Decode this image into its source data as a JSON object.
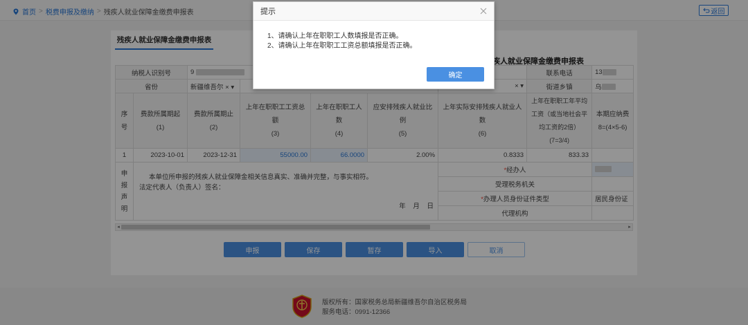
{
  "breadcrumb": {
    "home": "首页",
    "tax_link": "税费申报及缴纳",
    "current": "残疾人就业保障金缴费申报表",
    "sep": ">"
  },
  "back_label": "返回",
  "tab_label": "残疾人就业保障金缴费申报表",
  "form_title": "残疾人就业保障金缴费申报表",
  "info_rows": {
    "taxpayer_id_label": "纳税人识别号",
    "taxpayer_id_value": "9",
    "phone_label": "联系电话",
    "phone_value": "13",
    "province_label": "省份",
    "province_value": "新疆维吾尔",
    "province_clear": "×",
    "dropdown_arrow": "▾",
    "street_label": "街道乡镇",
    "street_value": "乌",
    "unknown_clear": "×"
  },
  "columns": [
    {
      "line1": "序号",
      "line2": ""
    },
    {
      "line1": "费款所属期起",
      "line2": "(1)"
    },
    {
      "line1": "费款所属期止",
      "line2": "(2)"
    },
    {
      "line1": "上年在职职工工资总额",
      "line2": "(3)"
    },
    {
      "line1": "上年在职职工人数",
      "line2": "(4)"
    },
    {
      "line1": "应安排残疾人就业比例",
      "line2": "(5)"
    },
    {
      "line1": "上年实际安排残疾人就业人数",
      "line2": "(6)"
    },
    {
      "line1": "上年在职职工年平均工资（或当地社会平均工资的2倍）",
      "line2": "(7=3/4)"
    },
    {
      "line1": "本期应纳费",
      "line2": "8=(4×5-6)"
    }
  ],
  "data_row": {
    "seq": "1",
    "start": "2023-10-01",
    "end": "2023-12-31",
    "wage_total": "55000.00",
    "staff_count": "66.0000",
    "ratio": "2.00%",
    "disabled_count": "0.8333",
    "avg_wage": "833.33",
    "due": ""
  },
  "declaration": {
    "side_chars": [
      "申",
      "报",
      "声",
      "明"
    ],
    "text": "本单位所申报的残疾人就业保障金相关信息真实、准确并完整，与事实相符。",
    "signature": "法定代表人（负责人）签名：",
    "date": "年 月 日",
    "agent_label": "经办人",
    "req_mark": "*",
    "tax_office_label": "受理税务机关",
    "id_type_label": "办理人员身份证件类型",
    "id_type_value": "居民身份证",
    "agency_label": "代理机构"
  },
  "buttons": {
    "submit": "申报",
    "save": "保存",
    "stash": "暂存",
    "import": "导入",
    "cancel": "取消"
  },
  "footer": {
    "copyright": "版权所有：国家税务总局新疆维吾尔自治区税务局",
    "service": "服务电话：0991-12366"
  },
  "dialog": {
    "title": "提示",
    "line1": "1、请确认上年在职职工人数填报是否正确。",
    "line2": "2、请确认上年在职职工工资总额填报是否正确。",
    "confirm": "确定"
  },
  "colors": {
    "accent": "#2a78d6",
    "button": "#4a90e2",
    "required": "#ee4433"
  }
}
